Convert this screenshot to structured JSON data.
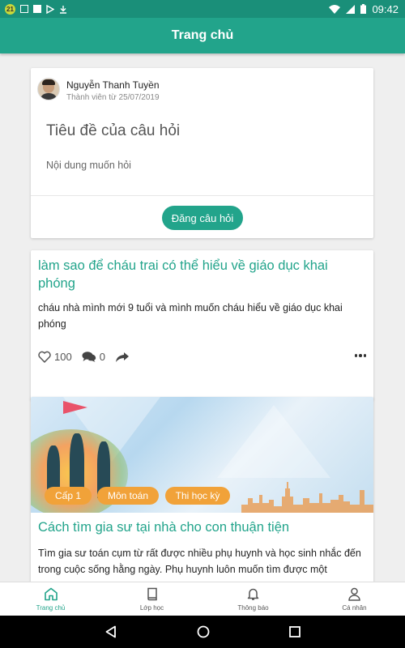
{
  "status_bar": {
    "notification_count": "21",
    "time": "09:42"
  },
  "app_bar": {
    "title": "Trang chủ"
  },
  "composer": {
    "user_name": "Nguyễn Thanh Tuyền",
    "member_since": "Thành viên từ 25/07/2019",
    "title_placeholder": "Tiêu đề của câu hỏi",
    "content_placeholder": "Nội dung muốn hỏi",
    "post_button": "Đăng câu hỏi"
  },
  "question": {
    "title": "làm sao để cháu trai có thể hiểu về giáo dục khai phóng",
    "body": "cháu nhà mình mới 9 tuổi và mình muốn cháu hiểu về giáo dục khai phóng",
    "likes": "100",
    "comments": "0"
  },
  "article": {
    "tags": [
      "Cấp 1",
      "Môn toán",
      "Thi học kỳ"
    ],
    "title": "Cách tìm gia sư tại nhà cho con thuận tiện",
    "excerpt": "Tìm gia sư toán cụm từ rất được nhiều phụ huynh và học sinh nhắc đến trong cuộc sống hằng ngày. Phụ huynh luôn muốn tìm được một"
  },
  "bottom_nav": {
    "items": [
      {
        "label": "Trang chủ",
        "icon": "home-icon",
        "active": true
      },
      {
        "label": "Lớp học",
        "icon": "book-icon"
      },
      {
        "label": "Thông báo",
        "icon": "bell-icon"
      },
      {
        "label": "Cá nhân",
        "icon": "user-icon"
      }
    ]
  },
  "colors": {
    "primary": "#22a48b",
    "status_bar": "#1a8f79",
    "tag": "#f1a239"
  }
}
